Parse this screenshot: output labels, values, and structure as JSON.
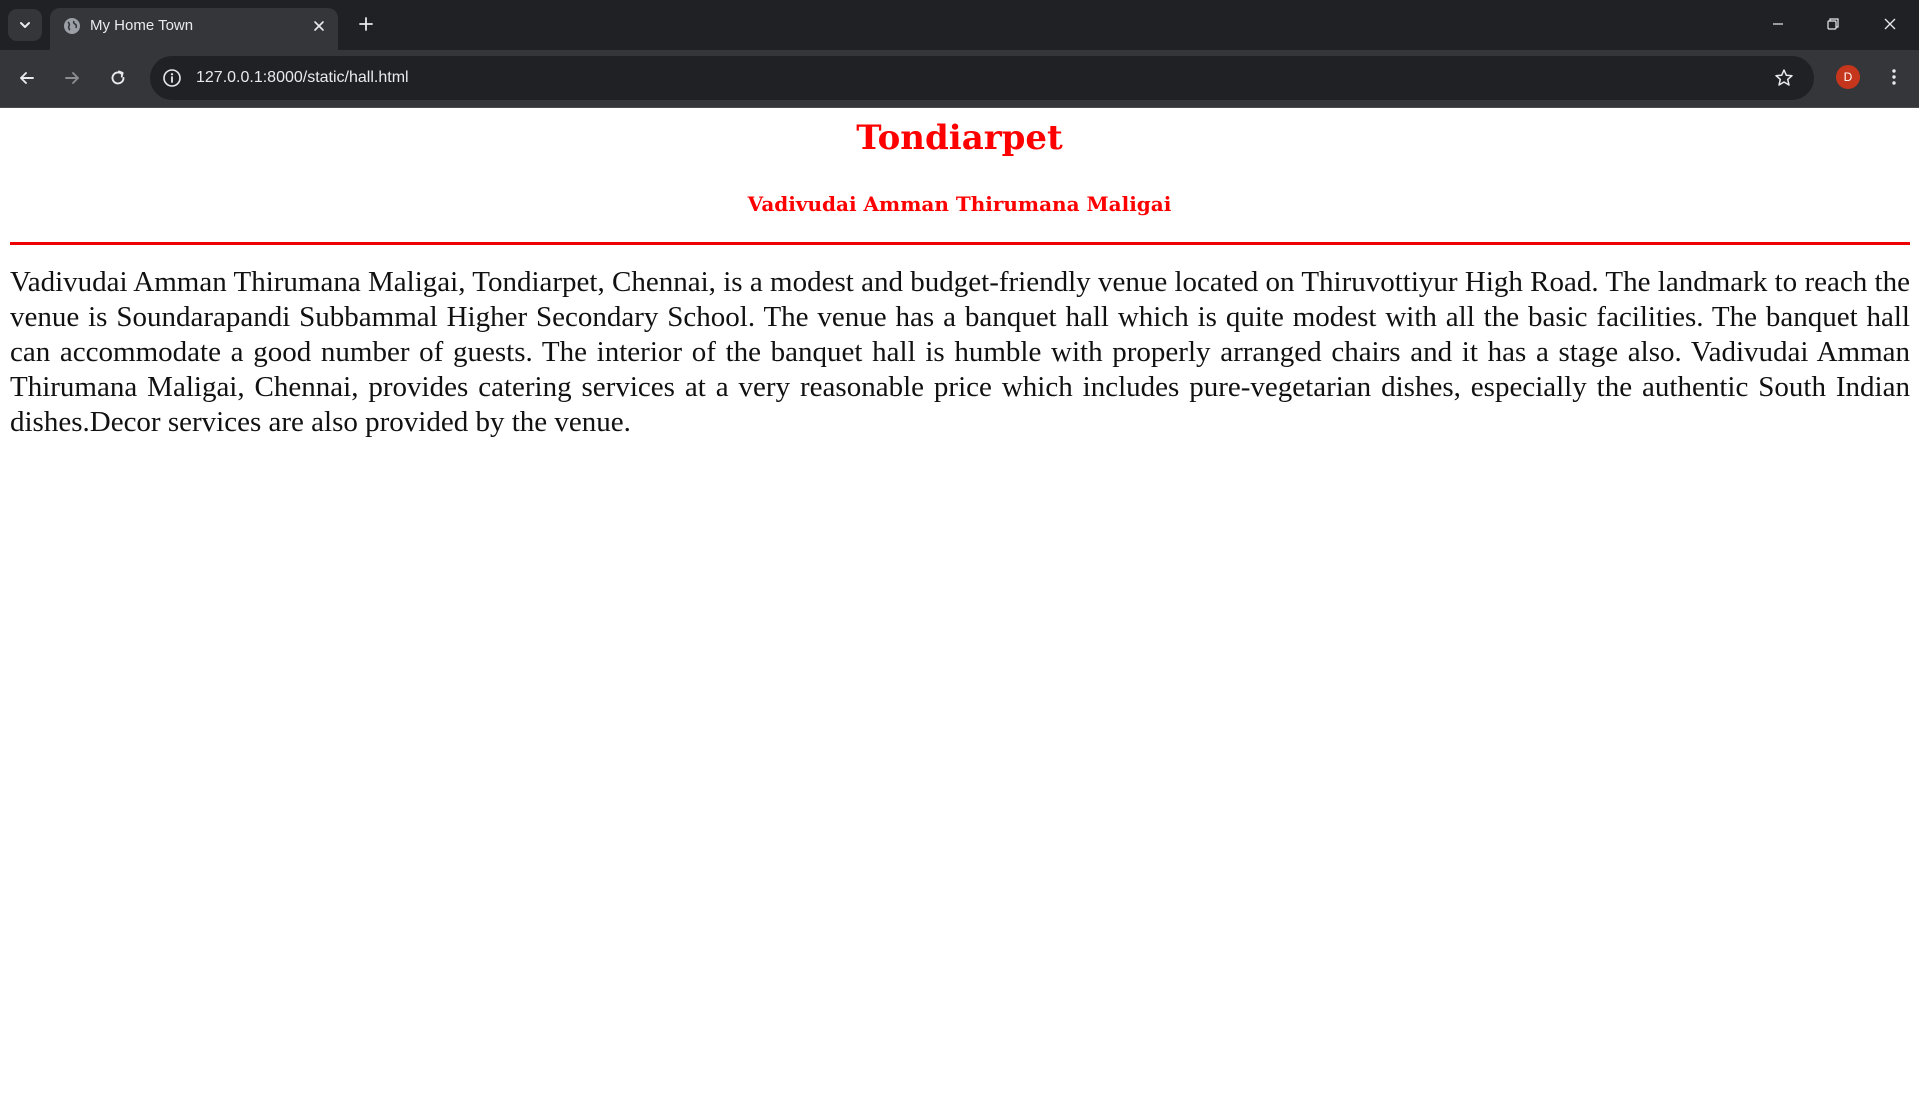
{
  "browser": {
    "tab_title": "My Home Town",
    "url": "127.0.0.1:8000/static/hall.html",
    "profile_initial": "D"
  },
  "page": {
    "title": "Tondiarpet",
    "venue_name": "Vadivudai Amman Thirumana Maligai",
    "description": "Vadivudai Amman Thirumana Maligai, Tondiarpet, Chennai, is a modest and budget-friendly venue located on Thiruvottiyur High Road. The landmark to reach the venue is Soundarapandi Subbammal Higher Secondary School. The venue has a banquet hall which is quite modest with all the basic facilities. The banquet hall can accommodate a good number of guests. The interior of the banquet hall is humble with properly arranged chairs and it has a stage also. Vadivudai Amman Thirumana Maligai, Chennai, provides catering services at a very reasonable price which includes pure-vegetarian dishes, especially the authentic South Indian dishes.Decor services are also provided by the venue."
  },
  "colors": {
    "heading": "#ff0000",
    "rule": "#ee0000",
    "body_text": "#111111"
  }
}
